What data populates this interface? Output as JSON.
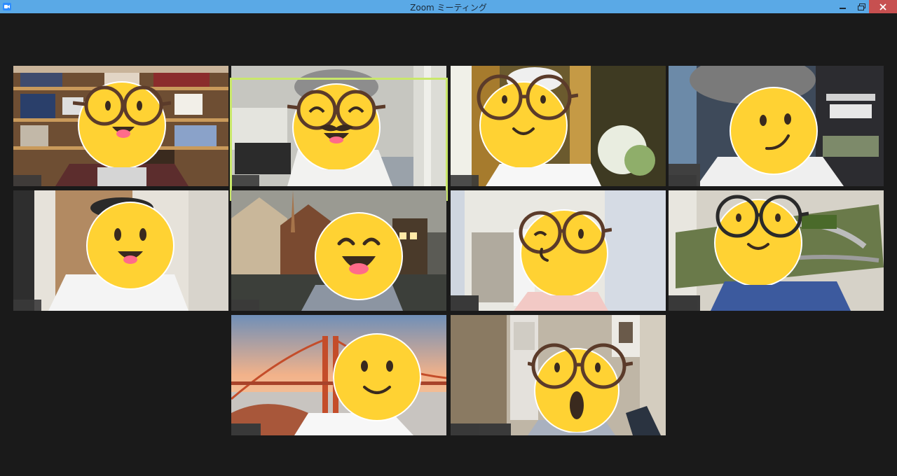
{
  "window": {
    "title": "Zoom ミーティング",
    "controls": [
      "minimize-icon",
      "maximize-icon",
      "close-icon"
    ]
  },
  "gallery": {
    "active_speaker_index": 1,
    "participants": [
      {
        "emoji": "grin-glasses",
        "background": "bookshelf"
      },
      {
        "emoji": "laugh-glasses-mustache",
        "background": "room"
      },
      {
        "emoji": "smile-glasses",
        "background": "curtains-flowers"
      },
      {
        "emoji": "smirk",
        "background": "shelves"
      },
      {
        "emoji": "grin",
        "background": "wall-door"
      },
      {
        "emoji": "laugh",
        "background": "german-town"
      },
      {
        "emoji": "wink-glasses",
        "background": "clothes-rack"
      },
      {
        "emoji": "smile-glasses",
        "background": "model-railway"
      },
      {
        "emoji": "smile",
        "background": "golden-gate-bridge"
      },
      {
        "emoji": "surprised-glasses",
        "background": "room-shelves"
      }
    ]
  }
}
